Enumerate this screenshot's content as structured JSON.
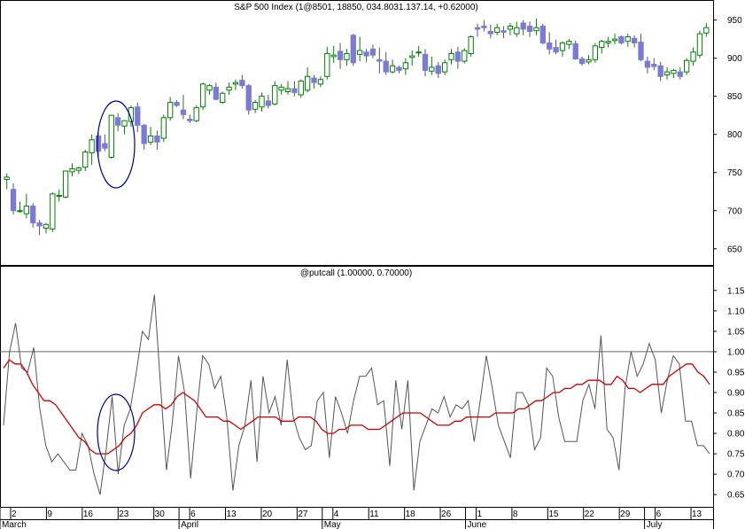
{
  "chart_data": [
    {
      "type": "candlestick",
      "title": "S&P 500 Index (1@8501, 18850, 034.8031.137.14, +0.62000)",
      "ylim": [
        630,
        960
      ],
      "y_ticks": [
        650,
        700,
        750,
        800,
        850,
        900,
        950
      ],
      "up_color": "#008000",
      "down_color": "#7b7bd6",
      "candles": [
        [
          741,
          749,
          728,
          744
        ],
        [
          728,
          736,
          695,
          700
        ],
        [
          700,
          712,
          697,
          700
        ],
        [
          696,
          722,
          690,
          706
        ],
        [
          706,
          710,
          678,
          684
        ],
        [
          684,
          688,
          668,
          680
        ],
        [
          677,
          684,
          670,
          682
        ],
        [
          676,
          724,
          672,
          722
        ],
        [
          719,
          728,
          712,
          720
        ],
        [
          718,
          752,
          716,
          752
        ],
        [
          751,
          762,
          745,
          755
        ],
        [
          753,
          758,
          748,
          756
        ],
        [
          757,
          780,
          752,
          777
        ],
        [
          776,
          800,
          760,
          793
        ],
        [
          798,
          806,
          768,
          778
        ],
        [
          788,
          800,
          778,
          782
        ],
        [
          770,
          826,
          768,
          825
        ],
        [
          822,
          828,
          804,
          812
        ],
        [
          811,
          818,
          800,
          818
        ],
        [
          817,
          838,
          810,
          835
        ],
        [
          836,
          842,
          803,
          812
        ],
        [
          812,
          814,
          780,
          788
        ],
        [
          790,
          810,
          786,
          798
        ],
        [
          798,
          805,
          780,
          790
        ],
        [
          795,
          826,
          790,
          822
        ],
        [
          822,
          849,
          818,
          842
        ],
        [
          842,
          845,
          836,
          838
        ],
        [
          832,
          852,
          820,
          826
        ],
        [
          820,
          826,
          815,
          818
        ],
        [
          818,
          838,
          816,
          835
        ],
        [
          836,
          868,
          832,
          866
        ],
        [
          858,
          866,
          852,
          864
        ],
        [
          862,
          868,
          845,
          846
        ],
        [
          842,
          856,
          840,
          854
        ],
        [
          858,
          868,
          852,
          862
        ],
        [
          866,
          872,
          858,
          868
        ],
        [
          871,
          878,
          860,
          864
        ],
        [
          864,
          866,
          826,
          832
        ],
        [
          833,
          845,
          828,
          842
        ],
        [
          836,
          855,
          830,
          850
        ],
        [
          844,
          852,
          834,
          838
        ],
        [
          840,
          870,
          838,
          864
        ],
        [
          858,
          866,
          852,
          862
        ],
        [
          856,
          870,
          852,
          860
        ],
        [
          860,
          870,
          850,
          855
        ],
        [
          852,
          872,
          848,
          870
        ],
        [
          858,
          888,
          855,
          876
        ],
        [
          874,
          878,
          860,
          868
        ],
        [
          866,
          876,
          862,
          872
        ],
        [
          876,
          915,
          872,
          906
        ],
        [
          902,
          916,
          894,
          904
        ],
        [
          909,
          920,
          886,
          898
        ],
        [
          898,
          912,
          890,
          906
        ],
        [
          930,
          932,
          890,
          894
        ],
        [
          905,
          928,
          896,
          910
        ],
        [
          908,
          912,
          895,
          903
        ],
        [
          912,
          918,
          900,
          904
        ],
        [
          898,
          914,
          880,
          896
        ],
        [
          896,
          908,
          878,
          882
        ],
        [
          882,
          898,
          880,
          890
        ],
        [
          888,
          890,
          880,
          884
        ],
        [
          886,
          900,
          878,
          894
        ],
        [
          901,
          910,
          890,
          903
        ],
        [
          908,
          916,
          902,
          908
        ],
        [
          905,
          912,
          876,
          884
        ],
        [
          883,
          902,
          878,
          888
        ],
        [
          890,
          895,
          874,
          880
        ],
        [
          882,
          898,
          878,
          894
        ],
        [
          898,
          912,
          892,
          906
        ],
        [
          908,
          915,
          886,
          896
        ],
        [
          896,
          913,
          893,
          910
        ],
        [
          906,
          930,
          902,
          928
        ],
        [
          940,
          945,
          928,
          938
        ],
        [
          942,
          950,
          935,
          940
        ],
        [
          935,
          944,
          926,
          932
        ],
        [
          934,
          945,
          930,
          940
        ],
        [
          936,
          942,
          926,
          934
        ],
        [
          938,
          946,
          930,
          942
        ],
        [
          932,
          948,
          928,
          940
        ],
        [
          946,
          950,
          930,
          938
        ],
        [
          942,
          948,
          928,
          935
        ],
        [
          936,
          952,
          930,
          940
        ],
        [
          942,
          945,
          918,
          920
        ],
        [
          920,
          934,
          905,
          912
        ],
        [
          914,
          924,
          905,
          908
        ],
        [
          910,
          922,
          902,
          920
        ],
        [
          918,
          925,
          912,
          922
        ],
        [
          919,
          923,
          898,
          899
        ],
        [
          899,
          902,
          890,
          893
        ],
        [
          895,
          904,
          892,
          898
        ],
        [
          898,
          920,
          894,
          916
        ],
        [
          914,
          924,
          906,
          922
        ],
        [
          920,
          928,
          914,
          922
        ],
        [
          923,
          932,
          918,
          925
        ],
        [
          928,
          930,
          918,
          920
        ],
        [
          922,
          932,
          915,
          928
        ],
        [
          926,
          930,
          914,
          920
        ],
        [
          921,
          932,
          896,
          898
        ],
        [
          896,
          902,
          880,
          888
        ],
        [
          892,
          900,
          884,
          889
        ],
        [
          890,
          895,
          870,
          876
        ],
        [
          878,
          888,
          872,
          882
        ],
        [
          880,
          886,
          874,
          884
        ],
        [
          882,
          888,
          872,
          876
        ],
        [
          882,
          900,
          878,
          897
        ],
        [
          896,
          914,
          890,
          908
        ],
        [
          904,
          936,
          900,
          932
        ],
        [
          933,
          946,
          928,
          940
        ]
      ]
    },
    {
      "type": "line",
      "title": "@putcall (1.00000, 0.70000)",
      "ylim": [
        0.62,
        1.18
      ],
      "y_ticks": [
        0.65,
        0.7,
        0.75,
        0.8,
        0.85,
        0.9,
        0.95,
        1.0,
        1.05,
        1.1,
        1.15
      ],
      "reference_line": 1.0,
      "series": [
        {
          "color": "#555555",
          "values": [
            0.82,
            1.0,
            1.07,
            0.96,
            0.95,
            1.01,
            0.86,
            0.77,
            0.73,
            0.75,
            0.73,
            0.71,
            0.71,
            0.8,
            0.77,
            0.7,
            0.65,
            0.76,
            0.89,
            0.7,
            0.82,
            0.86,
            0.95,
            1.05,
            1.03,
            1.14,
            0.92,
            0.71,
            0.83,
            0.99,
            0.9,
            0.69,
            0.85,
            0.99,
            0.97,
            0.91,
            0.94,
            0.84,
            0.66,
            0.77,
            0.82,
            0.93,
            0.73,
            0.94,
            0.85,
            0.89,
            0.82,
            0.98,
            0.84,
            0.79,
            0.76,
            0.77,
            0.88,
            0.9,
            0.74,
            0.89,
            0.85,
            0.8,
            0.88,
            0.94,
            0.94,
            0.96,
            0.87,
            0.88,
            0.72,
            0.93,
            0.81,
            0.93,
            0.66,
            0.78,
            0.82,
            0.86,
            0.85,
            0.89,
            0.84,
            0.87,
            0.86,
            0.88,
            0.78,
            0.88,
            0.99,
            0.91,
            0.82,
            0.78,
            0.74,
            0.9,
            0.9,
            0.87,
            0.76,
            0.79,
            0.96,
            0.94,
            0.84,
            0.78,
            0.78,
            0.78,
            0.88,
            0.92,
            0.86,
            1.04,
            0.81,
            0.79,
            0.71,
            0.91,
            1.0,
            0.94,
            0.97,
            1.02,
            0.98,
            0.85,
            0.93,
            0.99,
            0.97,
            0.83,
            0.83,
            0.77,
            0.77,
            0.75
          ]
        },
        {
          "color": "#cc0000",
          "values": [
            0.96,
            0.98,
            0.97,
            0.97,
            0.95,
            0.92,
            0.9,
            0.88,
            0.88,
            0.87,
            0.85,
            0.83,
            0.81,
            0.79,
            0.78,
            0.76,
            0.75,
            0.75,
            0.75,
            0.76,
            0.77,
            0.79,
            0.8,
            0.82,
            0.85,
            0.86,
            0.87,
            0.87,
            0.86,
            0.87,
            0.89,
            0.9,
            0.89,
            0.88,
            0.86,
            0.84,
            0.84,
            0.84,
            0.83,
            0.83,
            0.82,
            0.81,
            0.82,
            0.83,
            0.84,
            0.84,
            0.84,
            0.84,
            0.83,
            0.83,
            0.83,
            0.84,
            0.84,
            0.84,
            0.83,
            0.81,
            0.8,
            0.8,
            0.81,
            0.81,
            0.82,
            0.82,
            0.82,
            0.81,
            0.81,
            0.81,
            0.82,
            0.83,
            0.84,
            0.85,
            0.85,
            0.85,
            0.85,
            0.84,
            0.83,
            0.82,
            0.82,
            0.82,
            0.83,
            0.83,
            0.84,
            0.84,
            0.84,
            0.84,
            0.84,
            0.85,
            0.85,
            0.85,
            0.85,
            0.86,
            0.86,
            0.87,
            0.88,
            0.88,
            0.89,
            0.9,
            0.9,
            0.91,
            0.91,
            0.92,
            0.92,
            0.93,
            0.93,
            0.93,
            0.92,
            0.92,
            0.94,
            0.93,
            0.91,
            0.91,
            0.9,
            0.91,
            0.92,
            0.92,
            0.92,
            0.94,
            0.95,
            0.96,
            0.97,
            0.97,
            0.95,
            0.94,
            0.92
          ]
        }
      ]
    }
  ],
  "x_axis": {
    "day_ticks": [
      "2",
      "9",
      "16",
      "23",
      "30",
      "6",
      "13",
      "20",
      "27",
      "4",
      "11",
      "18",
      "26",
      "1",
      "8",
      "15",
      "22",
      "29",
      "6",
      "13"
    ],
    "months": [
      "March",
      "April",
      "May",
      "June",
      "July"
    ]
  },
  "annotations": {
    "circle_color": "#000099"
  }
}
